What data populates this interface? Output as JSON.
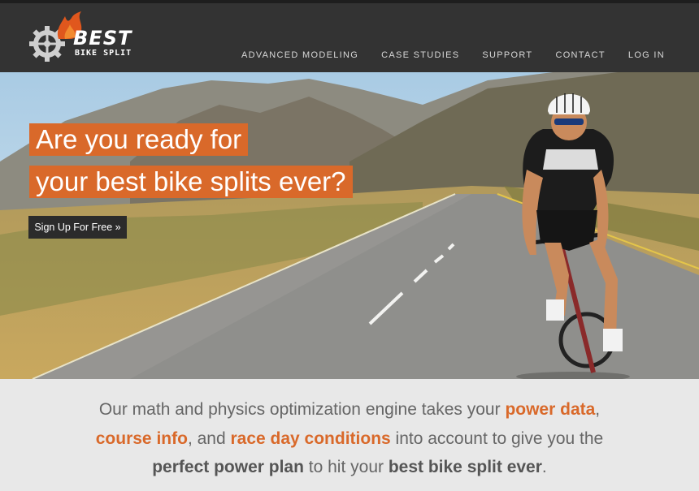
{
  "brand": {
    "name_main": "BEST",
    "name_sub": "BIKE SPLIT"
  },
  "nav": {
    "items": [
      {
        "label": "ADVANCED MODELING"
      },
      {
        "label": "CASE STUDIES"
      },
      {
        "label": "SUPPORT"
      },
      {
        "label": "CONTACT"
      },
      {
        "label": "LOG IN"
      }
    ]
  },
  "hero": {
    "headline_line1": "Are you ready for",
    "headline_line2": "your best bike splits ever?",
    "cta_label": "Sign Up For Free »",
    "image": "cyclist-on-road-photo"
  },
  "tagline": {
    "p1": "Our math and physics optimization engine takes your ",
    "h1": "power data",
    "p2": ",",
    "h2": "course info",
    "p3": ", and ",
    "h3": "race day conditions",
    "p4": " into account to give you the",
    "b1": "perfect power plan",
    "p5": " to hit your ",
    "b2": "best bike split ever",
    "p6": "."
  },
  "colors": {
    "accent": "#d9692a",
    "nav_bg": "#333333",
    "band_bg": "#e8e8e8"
  }
}
